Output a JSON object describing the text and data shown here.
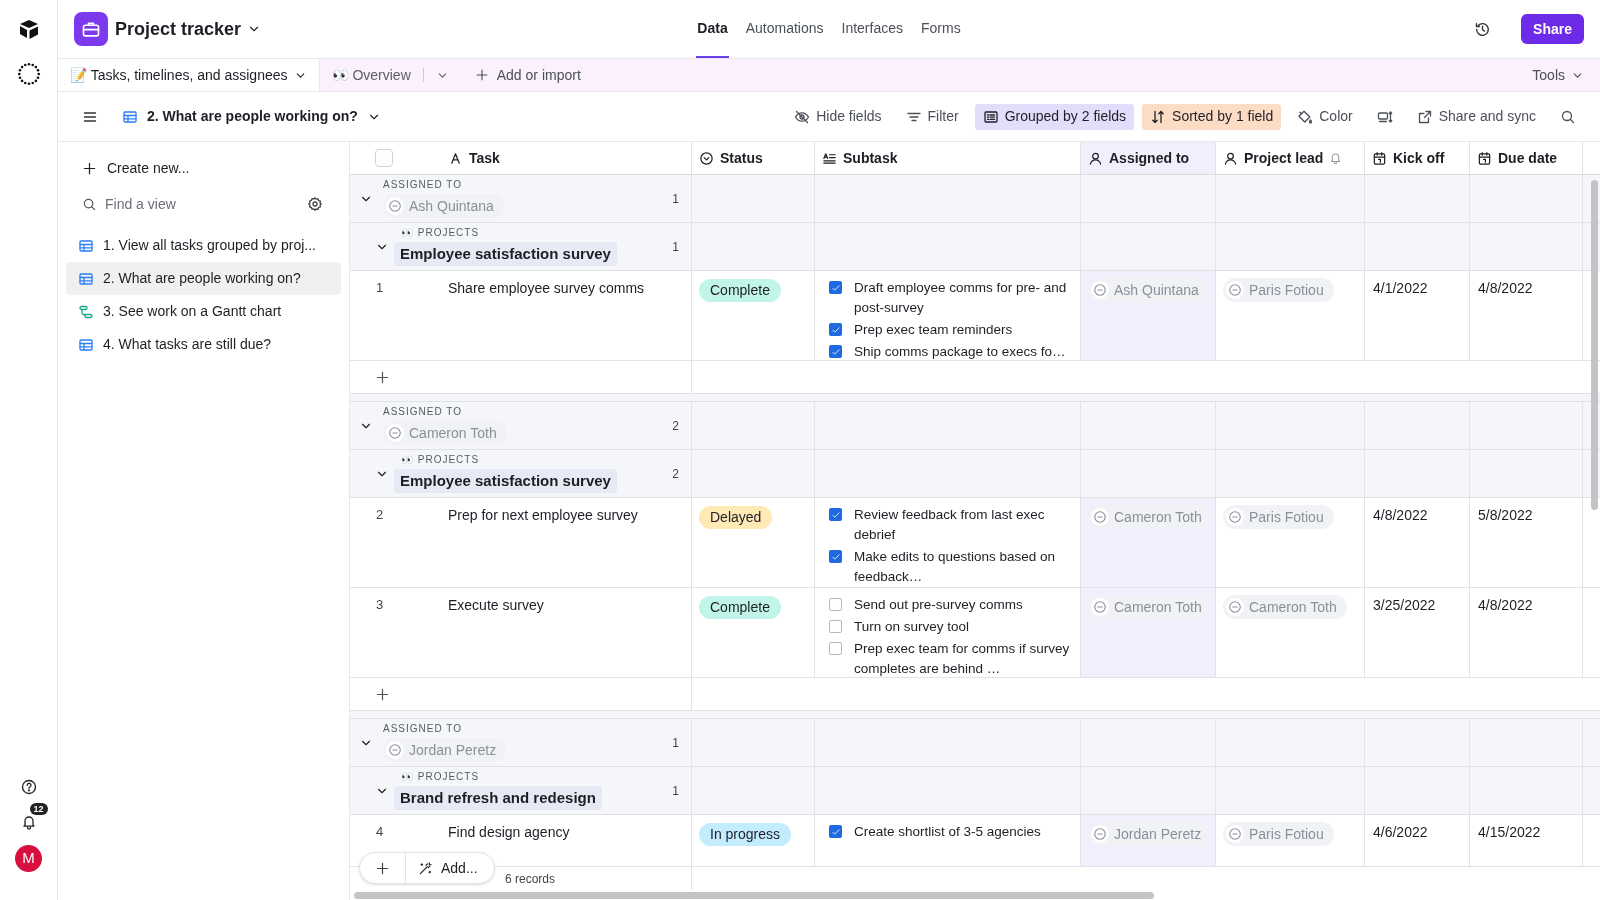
{
  "rail": {
    "notifications": "12",
    "avatar": "M"
  },
  "base": {
    "name": "Project tracker"
  },
  "nav_tabs": [
    {
      "label": "Data",
      "selected": true
    },
    {
      "label": "Automations",
      "selected": false
    },
    {
      "label": "Interfaces",
      "selected": false
    },
    {
      "label": "Forms",
      "selected": false
    }
  ],
  "share_button": "Share",
  "tables": [
    {
      "emoji": "📝",
      "label": "Tasks, timelines, and assignees",
      "selected": true
    },
    {
      "emoji": "👀",
      "label": "Overview",
      "selected": false
    }
  ],
  "add_or_import": "Add or import",
  "tools": "Tools",
  "view": {
    "name": "2. What are people working on?"
  },
  "toolbar": [
    {
      "kind": "hide",
      "label": "Hide fields"
    },
    {
      "kind": "filter",
      "label": "Filter"
    },
    {
      "kind": "group",
      "label": "Grouped by 2 fields"
    },
    {
      "kind": "sort",
      "label": "Sorted by 1 field"
    },
    {
      "kind": "color",
      "label": "Color"
    },
    {
      "kind": "row_height"
    },
    {
      "kind": "share",
      "label": "Share and sync"
    },
    {
      "kind": "search"
    }
  ],
  "sidebar": {
    "create": "Create new...",
    "search_placeholder": "Find a view",
    "views": [
      {
        "kind": "grid",
        "label": "1. View all tasks grouped by proj...",
        "selected": false
      },
      {
        "kind": "grid",
        "label": "2. What are people working on?",
        "selected": true
      },
      {
        "kind": "gantt",
        "label": "3. See work on a Gantt chart",
        "selected": false
      },
      {
        "kind": "grid",
        "label": "4. What tasks are still due?",
        "selected": false
      }
    ]
  },
  "table": {
    "select_all": {
      "checked": false
    },
    "columns": [
      {
        "kind": "text",
        "label": "Task",
        "highlighted": false
      },
      {
        "kind": "status",
        "label": "Status",
        "highlighted": false
      },
      {
        "kind": "long_text",
        "label": "Subtask",
        "highlighted": false
      },
      {
        "kind": "user",
        "label": "Assigned to",
        "highlighted": true
      },
      {
        "kind": "user_notify",
        "label": "Project lead",
        "highlighted": false
      },
      {
        "kind": "date",
        "label": "Kick off",
        "highlighted": false
      },
      {
        "kind": "date",
        "label": "Due date",
        "highlighted": false
      }
    ],
    "groups": [
      {
        "label": "ASSIGNED TO",
        "value": "Ash Quintana",
        "count": "1",
        "subgroups": [
          {
            "emoji": "👀",
            "label": "PROJECTS",
            "value": "Employee satisfaction survey",
            "count": "1",
            "records": [
              {
                "number": "1",
                "task": "Share employee survey comms",
                "status": {
                  "label": "Complete",
                  "color": "#c2f5e9"
                },
                "subtasks": [
                  {
                    "text": "Draft employee comms for pre- and post-survey",
                    "checked": true
                  },
                  {
                    "text": "Prep exec team reminders",
                    "checked": true
                  },
                  {
                    "text": "Ship comms package to execs fo…",
                    "checked": true
                  }
                ],
                "assigned_to": "Ash Quintana",
                "project_lead": "Paris Fotiou",
                "kick_off": "4/1/2022",
                "due_date": "4/8/2022"
              }
            ]
          }
        ]
      },
      {
        "label": "ASSIGNED TO",
        "value": "Cameron Toth",
        "count": "2",
        "subgroups": [
          {
            "emoji": "👀",
            "label": "PROJECTS",
            "value": "Employee satisfaction survey",
            "count": "2",
            "records": [
              {
                "number": "2",
                "task": "Prep for next employee survey",
                "status": {
                  "label": "Delayed",
                  "color": "#ffeab6"
                },
                "subtasks": [
                  {
                    "text": "Review feedback from last exec debrief",
                    "checked": true
                  },
                  {
                    "text": "Make edits to questions based on feedback…",
                    "checked": true
                  }
                ],
                "assigned_to": "Cameron Toth",
                "project_lead": "Paris Fotiou",
                "kick_off": "4/8/2022",
                "due_date": "5/8/2022"
              },
              {
                "number": "3",
                "task": "Execute survey",
                "status": {
                  "label": "Complete",
                  "color": "#c2f5e9"
                },
                "subtasks": [
                  {
                    "text": "Send out pre-survey comms",
                    "checked": false
                  },
                  {
                    "text": "Turn on survey tool",
                    "checked": false
                  },
                  {
                    "text": "Prep exec team for comms if survey completes are behind …",
                    "checked": false
                  }
                ],
                "assigned_to": "Cameron Toth",
                "project_lead": "Cameron Toth",
                "kick_off": "3/25/2022",
                "due_date": "4/8/2022"
              }
            ]
          }
        ]
      },
      {
        "label": "ASSIGNED TO",
        "value": "Jordan Peretz",
        "count": "1",
        "subgroups": [
          {
            "emoji": "👀",
            "label": "PROJECTS",
            "value": "Brand refresh and redesign",
            "count": "1",
            "records": [
              {
                "number": "4",
                "task": "Find design agency",
                "status": {
                  "label": "In progress",
                  "color": "#c4ecff"
                },
                "subtasks": [
                  {
                    "text": "Create shortlist of 3-5 agencies",
                    "checked": true
                  }
                ],
                "assigned_to": "Jordan Peretz",
                "project_lead": "Paris Fotiou",
                "kick_off": "4/6/2022",
                "due_date": "4/15/2022"
              }
            ]
          }
        ]
      }
    ]
  },
  "footer": {
    "add": "Add...",
    "records": "6 records"
  }
}
